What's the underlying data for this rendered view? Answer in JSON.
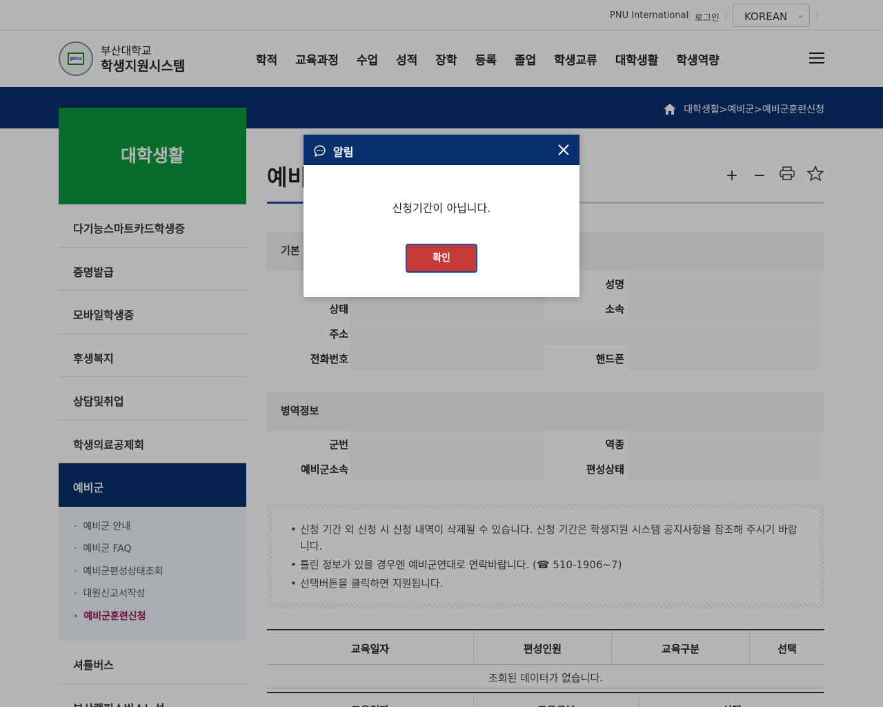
{
  "utility": {
    "international": "PNU International",
    "login": "로그인",
    "language": "KOREAN"
  },
  "header": {
    "logo_line1": "부산대학교",
    "logo_line2": "학생지원시스템",
    "logo_mark": "pnu",
    "nav": [
      "학적",
      "교육과정",
      "수업",
      "성적",
      "장학",
      "등록",
      "졸업",
      "학생교류",
      "대학생활",
      "학생역량"
    ]
  },
  "breadcrumb": "대학생활>예비군>예비군훈련신청",
  "sidebar": {
    "title": "대학생활",
    "items": [
      "다기능스마트카드학생증",
      "증명발급",
      "모바일학생증",
      "후생복지",
      "상담및취업",
      "학생의료공제회",
      "예비군"
    ],
    "sub_items": [
      "예비군 안내",
      "예비군 FAQ",
      "예비군편성상태조회",
      "대원신고서작성",
      "예비군훈련신청"
    ],
    "after_items": [
      "셔틀버스",
      "부산캠퍼스버스노선"
    ]
  },
  "content": {
    "title_partial": "예비",
    "tools": [
      "+",
      "−",
      "print-icon",
      "star-icon"
    ],
    "basic_section_partial": "기본",
    "basic_fields": {
      "name": "성명",
      "status": "상태",
      "dept": "소속",
      "address": "주소",
      "phone": "전화번호",
      "mobile": "핸드폰"
    },
    "military_section": "병역정보",
    "military_fields": {
      "unit": "군번",
      "branch": "역종",
      "reserve_unit": "예비군소속",
      "org_status": "편성상태"
    },
    "notices": [
      "신청 기간 외 신청 시 신청 내역이 삭제될 수 있습니다. 신청 기간은 학생지원 시스템 공지사항을 참조해 주시기 바랍니다.",
      "틀린 정보가 있을 경우엔 예비군연대로 연락바랍니다. (☎ 510-1906~7)",
      "선택버튼을 클릭하면 지원됩니다."
    ],
    "table_headers": [
      "교육일자",
      "편성인원",
      "교육구분",
      "선택"
    ],
    "table_empty": "조회된 데이터가 없습니다.",
    "table2_headers": [
      "교육일자",
      "교육구분",
      "선택"
    ]
  },
  "modal": {
    "title": "알림",
    "message": "신청기간이 아닙니다.",
    "ok": "확인"
  }
}
